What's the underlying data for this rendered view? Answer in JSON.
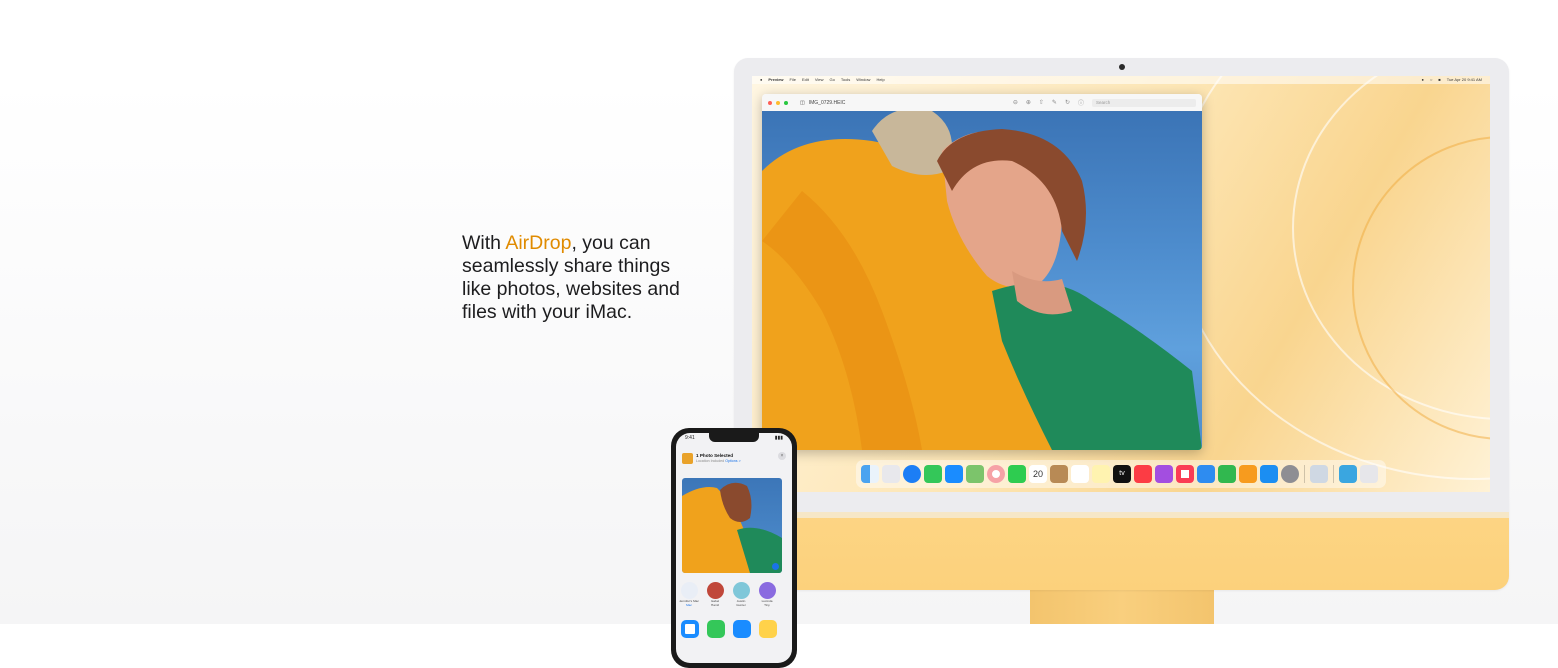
{
  "copy": {
    "text_before": "With ",
    "accent": "AirDrop",
    "text_after": ", you can seamlessly share things like photos, websites and files with your iMac.",
    "accent_color": "#e08b00"
  },
  "imac": {
    "color": "#fdd584",
    "menubar": {
      "app_menu": [
        "Preview",
        "File",
        "Edit",
        "View",
        "Go",
        "Tools",
        "Window",
        "Help"
      ],
      "clock": "Tue Apr 20  9:41 AM"
    },
    "preview_window": {
      "filename": "IMG_0729.HEIC",
      "search_placeholder": "Search"
    },
    "dock": {
      "icons": [
        "finder-icon",
        "launchpad-icon",
        "safari-icon",
        "messages-icon",
        "mail-icon",
        "maps-icon",
        "photos-icon",
        "facetime-icon",
        "calendar-icon",
        "contacts-icon",
        "reminders-icon",
        "notes-icon",
        "tv-icon",
        "music-icon",
        "podcasts-icon",
        "news-icon",
        "keynote-icon",
        "numbers-icon",
        "pages-icon",
        "app-store-icon",
        "system-preferences-icon",
        "preview-icon",
        "downloads-folder-icon",
        "trash-icon"
      ],
      "calendar_day": "20",
      "tv_label": "tv"
    }
  },
  "iphone": {
    "time": "9:41",
    "share_sheet": {
      "title": "1 Photo Selected",
      "subtitle": "Location Included",
      "options_label": "Options >",
      "people": [
        {
          "name": "Jennifer's Mac",
          "sub": "Mac"
        },
        {
          "name": "Isabel",
          "sub": "Hamil"
        },
        {
          "name": "Austin",
          "sub": "Gunter"
        },
        {
          "name": "Lucinda",
          "sub": "Tiny"
        }
      ]
    }
  }
}
